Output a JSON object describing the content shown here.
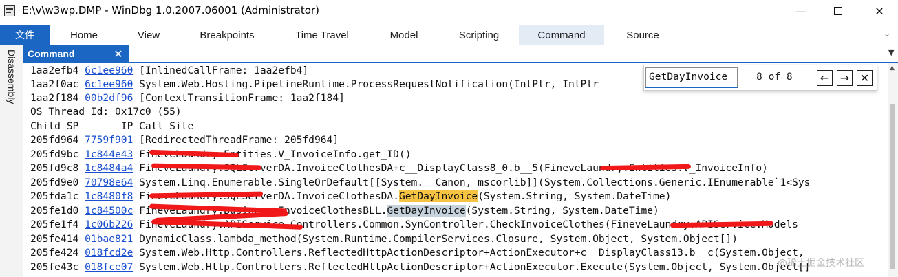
{
  "window": {
    "title": "E:\\v\\w3wp.DMP - WinDbg 1.0.2007.06001 (Administrator)",
    "minimize": "—",
    "close": "✕"
  },
  "ribbon": {
    "file": "文件",
    "tabs": [
      "Home",
      "View",
      "Breakpoints",
      "Time Travel",
      "Model",
      "Scripting",
      "Command",
      "Source"
    ],
    "active_tab": "Command",
    "collapse_icon": "⌄"
  },
  "left_strip": {
    "tab": "Disassembly"
  },
  "pane": {
    "title": "Command",
    "close": "✕",
    "dropdown_icon": "▼"
  },
  "find": {
    "value": "GetDayInvoice",
    "count": "8 of 8",
    "prev": "←",
    "next": "→",
    "close": "✕"
  },
  "output": {
    "lines": [
      {
        "addr": "1aa2efb4 ",
        "link": "6c1ee960",
        "text": " [InlinedCallFrame: 1aa2efb4]"
      },
      {
        "addr": "1aa2f0ac ",
        "link": "6c1ee960",
        "text": " System.Web.Hosting.PipelineRuntime.ProcessRequestNotification(IntPtr, IntPtr"
      },
      {
        "addr": "1aa2f184 ",
        "link": "00b2df96",
        "text": " [ContextTransitionFrame: 1aa2f184]"
      },
      {
        "addr": "",
        "link": "",
        "text": "OS Thread Id: 0x17c0 (55)"
      },
      {
        "addr": "",
        "link": "",
        "text": "Child SP       IP Call Site"
      },
      {
        "addr": "205fd964 ",
        "link": "7759f901",
        "text": " [RedirectedThreadFrame: 205fd964]"
      },
      {
        "addr": "205fd9bc ",
        "link": "1c844e43",
        "text": " FineveLaundry.Entities.V_InvoiceInfo.get_ID()"
      },
      {
        "addr": "205fd9c8 ",
        "link": "1c8484a4",
        "text": " FineveLaundry.SQLServerDA.InvoiceClothesDA+c__DisplayClass8_0.b__5(FineveLaundry.Entities.V_InvoiceInfo)"
      },
      {
        "addr": "205fd9e0 ",
        "link": "70798e64",
        "text": " System.Linq.Enumerable.SingleOrDefault[[System.__Canon, mscorlib]](System.Collections.Generic.IEnumerable`1<Sys"
      },
      {
        "addr": "205fda1c ",
        "link": "1c8480f8",
        "pre": " FineveLaundry.SQLServerDA.InvoiceClothesDA.",
        "match": "GetDayInvoice",
        "post": "(System.String, System.DateTime)"
      },
      {
        "addr": "205fe1d0 ",
        "link": "1c84500c",
        "pre": " FineveLaundry.Business.InvoiceClothesBLL.",
        "match": "GetDayInvoice",
        "post": "(System.String, System.DateTime)"
      },
      {
        "addr": "205fe1f4 ",
        "link": "1c06b226",
        "text": " FineveLaundry.APIService.Controllers.Common.SynController.CheckInvoiceClothes(FineveLaundry.APIService.Models"
      },
      {
        "addr": "205fe414 ",
        "link": "01bae821",
        "text": " DynamicClass.lambda_method(System.Runtime.CompilerServices.Closure, System.Object, System.Object[])"
      },
      {
        "addr": "205fe424 ",
        "link": "018fcd2e",
        "text": " System.Web.Http.Controllers.ReflectedHttpActionDescriptor+ActionExecutor+c__DisplayClass13.b__c(System.Object,"
      },
      {
        "addr": "205fe43c ",
        "link": "018fce07",
        "text": " System.Web.Http.Controllers.ReflectedHttpActionDescriptor+ActionExecutor.Execute(System.Object, System.Object[]"
      }
    ]
  },
  "watermark": "@稀土掘金技术社区"
}
